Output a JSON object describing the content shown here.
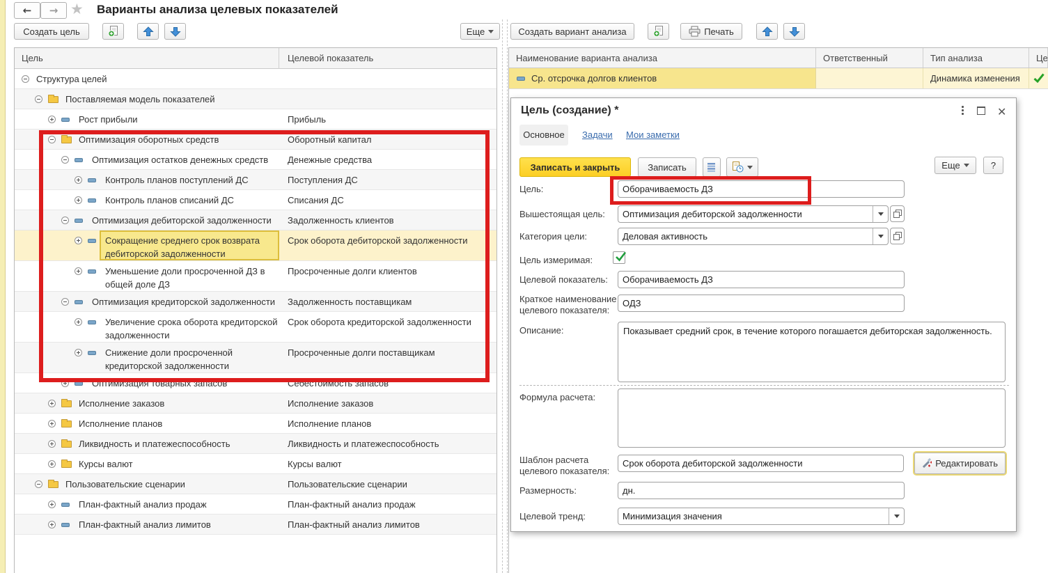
{
  "app": {
    "title": "Варианты анализа целевых показателей"
  },
  "left_panel": {
    "create_goal_button": "Создать цель",
    "more_button": "Еще",
    "columns": [
      "Цель",
      "Целевой показатель"
    ],
    "rows": [
      {
        "level": 0,
        "expander": "minus",
        "icon": "none",
        "goal": "Структура целей",
        "indicator": "",
        "two_line": false,
        "stripe": false,
        "selected": false
      },
      {
        "level": 1,
        "expander": "minus",
        "icon": "folder",
        "goal": "Поставляемая модель показателей",
        "indicator": "",
        "two_line": false,
        "stripe": true,
        "selected": false
      },
      {
        "level": 2,
        "expander": "plus",
        "icon": "dash",
        "goal": "Рост прибыли",
        "indicator": "Прибыль",
        "two_line": false,
        "stripe": false,
        "selected": false
      },
      {
        "level": 2,
        "expander": "minus",
        "icon": "folder",
        "goal": "Оптимизация оборотных средств",
        "indicator": "Оборотный капитал",
        "two_line": false,
        "stripe": true,
        "selected": false
      },
      {
        "level": 3,
        "expander": "minus",
        "icon": "dash",
        "goal": "Оптимизация остатков денежных средств",
        "indicator": "Денежные средства",
        "two_line": false,
        "stripe": false,
        "selected": false
      },
      {
        "level": 4,
        "expander": "plus",
        "icon": "dash",
        "goal": "Контроль планов поступлений ДС",
        "indicator": "Поступления ДС",
        "two_line": false,
        "stripe": true,
        "selected": false
      },
      {
        "level": 4,
        "expander": "plus",
        "icon": "dash",
        "goal": "Контроль планов списаний ДС",
        "indicator": "Списания ДС",
        "two_line": false,
        "stripe": false,
        "selected": false
      },
      {
        "level": 3,
        "expander": "minus",
        "icon": "dash",
        "goal": "Оптимизация дебиторской задолженности",
        "indicator": "Задолженность клиентов",
        "two_line": false,
        "stripe": true,
        "selected": false
      },
      {
        "level": 4,
        "expander": "plus",
        "icon": "dash",
        "goal": "Сокращение среднего срок возврата дебиторской задолженности",
        "indicator": "Срок оборота дебиторской задолженности",
        "two_line": true,
        "stripe": false,
        "selected": true
      },
      {
        "level": 4,
        "expander": "plus",
        "icon": "dash",
        "goal": "Уменьшение доли просроченной ДЗ в общей доле ДЗ",
        "indicator": "Просроченные долги клиентов",
        "two_line": true,
        "stripe": false,
        "selected": false
      },
      {
        "level": 3,
        "expander": "minus",
        "icon": "dash",
        "goal": "Оптимизация кредиторской задолженности",
        "indicator": "Задолженность поставщикам",
        "two_line": false,
        "stripe": true,
        "selected": false
      },
      {
        "level": 4,
        "expander": "plus",
        "icon": "dash",
        "goal": "Увеличение срока оборота кредиторской задолженности",
        "indicator": "Срок оборота кредиторской задолженности",
        "two_line": true,
        "stripe": false,
        "selected": false
      },
      {
        "level": 4,
        "expander": "plus",
        "icon": "dash",
        "goal": "Снижение доли просроченной кредиторской задолженности",
        "indicator": "Просроченные долги поставщикам",
        "two_line": true,
        "stripe": true,
        "selected": false
      },
      {
        "level": 3,
        "expander": "plus",
        "icon": "dash",
        "goal": "Оптимизация товарных запасов",
        "indicator": "Себестоимость запасов",
        "two_line": false,
        "stripe": false,
        "selected": false
      },
      {
        "level": 2,
        "expander": "plus",
        "icon": "folder",
        "goal": "Исполнение заказов",
        "indicator": "Исполнение заказов",
        "two_line": false,
        "stripe": true,
        "selected": false
      },
      {
        "level": 2,
        "expander": "plus",
        "icon": "folder",
        "goal": "Исполнение планов",
        "indicator": "Исполнение планов",
        "two_line": false,
        "stripe": false,
        "selected": false
      },
      {
        "level": 2,
        "expander": "plus",
        "icon": "folder",
        "goal": "Ликвидность и платежеспособность",
        "indicator": "Ликвидность и платежеспособность",
        "two_line": false,
        "stripe": true,
        "selected": false
      },
      {
        "level": 2,
        "expander": "plus",
        "icon": "folder",
        "goal": "Курсы валют",
        "indicator": "Курсы валют",
        "two_line": false,
        "stripe": false,
        "selected": false
      },
      {
        "level": 1,
        "expander": "minus",
        "icon": "folder",
        "goal": "Пользовательские сценарии",
        "indicator": "Пользовательские сценарии",
        "two_line": false,
        "stripe": true,
        "selected": false
      },
      {
        "level": 2,
        "expander": "plus",
        "icon": "dash",
        "goal": "План-фактный анализ продаж",
        "indicator": "План-фактный анализ продаж",
        "two_line": false,
        "stripe": false,
        "selected": false
      },
      {
        "level": 2,
        "expander": "plus",
        "icon": "dash",
        "goal": "План-фактный анализ лимитов",
        "indicator": "План-фактный анализ лимитов",
        "two_line": false,
        "stripe": true,
        "selected": false
      }
    ]
  },
  "right_panel": {
    "create_variant_button": "Создать вариант анализа",
    "print_button": "Печать",
    "columns": [
      "Наименование варианта анализа",
      "Ответственный",
      "Тип анализа",
      "Цел"
    ],
    "rows": [
      {
        "name": "Ср. отсрочка долгов клиентов",
        "responsible": "",
        "type": "Динамика изменения",
        "target": true
      }
    ]
  },
  "dialog": {
    "title": "Цель (создание) *",
    "tabs": {
      "main": "Основное",
      "tasks": "Задачи",
      "notes": "Мои заметки"
    },
    "commands": {
      "save_close": "Записать и закрыть",
      "save": "Записать",
      "more": "Еще",
      "help": "?"
    },
    "fields": {
      "goal": {
        "label": "Цель:",
        "value": "Оборачиваемость ДЗ"
      },
      "parent_goal": {
        "label": "Вышестоящая цель:",
        "value": "Оптимизация дебиторской задолженности"
      },
      "category": {
        "label": "Категория цели:",
        "value": "Деловая активность"
      },
      "measurable": {
        "label": "Цель измеримая:",
        "checked": true
      },
      "indicator": {
        "label": "Целевой показатель:",
        "value": "Оборачиваемость ДЗ"
      },
      "short_name": {
        "label": "Краткое наименование целевого показателя:",
        "value": "ОДЗ"
      },
      "description": {
        "label": "Описание:",
        "value": "Показывает средний срок, в течение которого погашается дебиторская задолженность."
      },
      "formula": {
        "label": "Формула расчета:",
        "value": ""
      },
      "template": {
        "label": "Шаблон расчета целевого показателя:",
        "value": "Срок оборота дебиторской задолженности",
        "edit_button": "Редактировать"
      },
      "dimension": {
        "label": "Размерность:",
        "value": "дн."
      },
      "trend": {
        "label": "Целевой тренд:",
        "value": "Минимизация значения"
      }
    }
  },
  "colors": {
    "annotation_red": "#dd1d1d",
    "selection_row_yellow": "#fdf2cb",
    "selection_cell_yellow": "#f8e88d",
    "selection_cell_border": "#dcbe3c",
    "primary_button_yellow": "#fdd63a",
    "link_blue": "#3a6cad",
    "check_green": "#28a228",
    "arrow_blue": "#4390d9",
    "folder_yellow": "#f5c843",
    "left_strip_yellow": "#f5eeb4"
  }
}
